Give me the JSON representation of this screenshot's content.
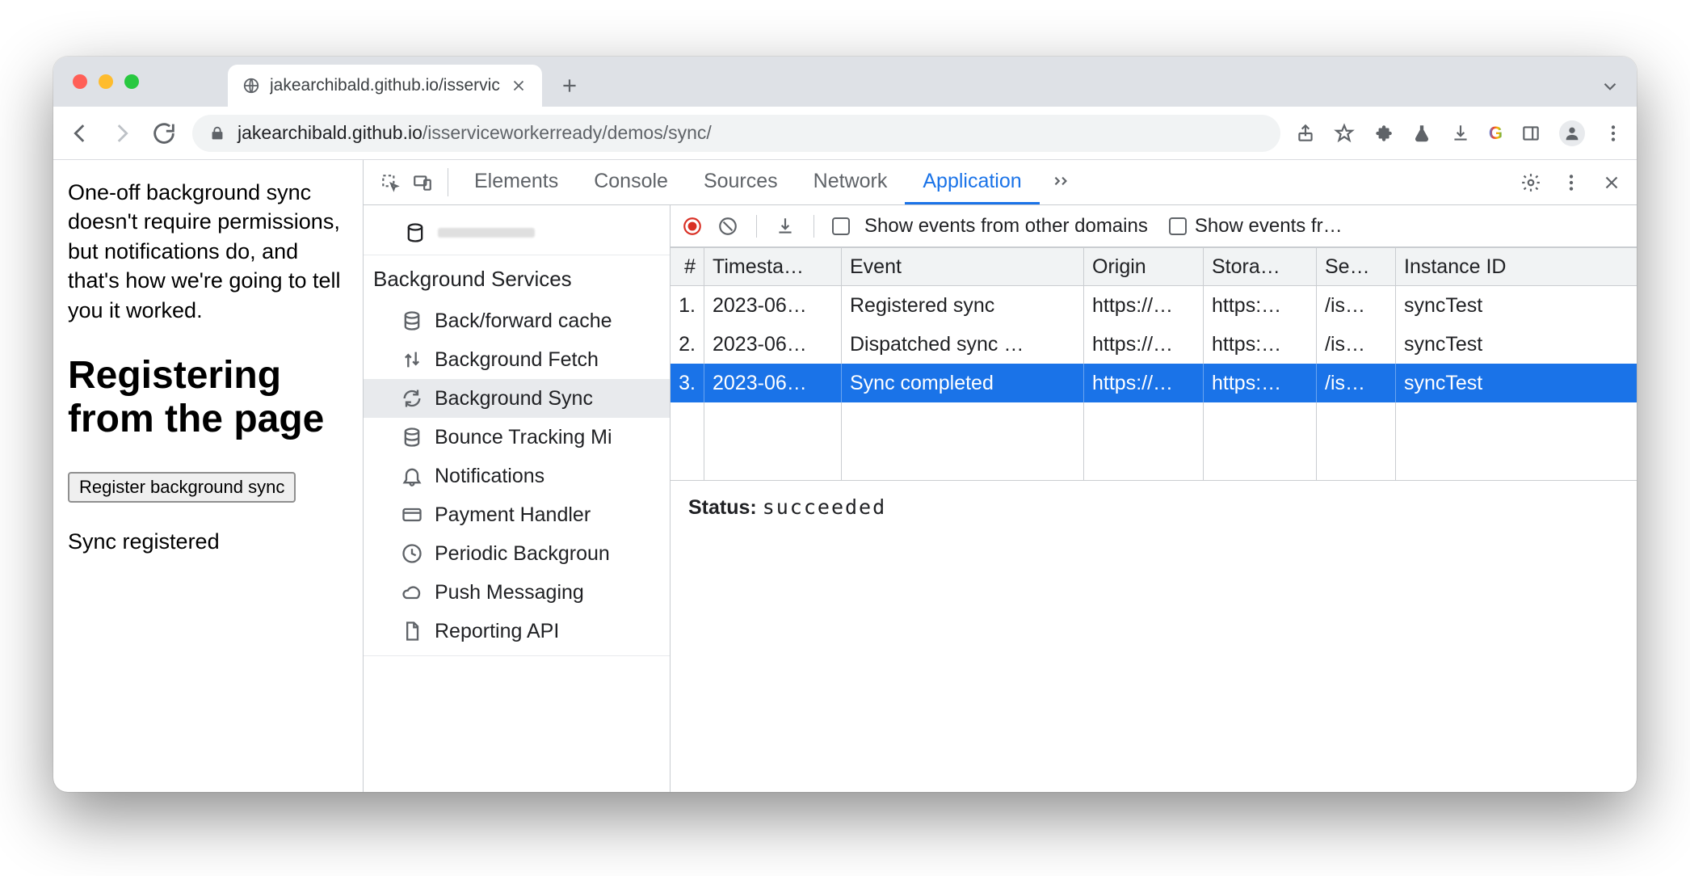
{
  "tab": {
    "title": "jakearchibald.github.io/isservic"
  },
  "omnibox": {
    "host": "jakearchibald.github.io",
    "path": "/isserviceworkerready/demos/sync/"
  },
  "page": {
    "intro": "One-off background sync doesn't require permissions, but notifications do, and that's how we're going to tell you it worked.",
    "heading": "Registering from the page",
    "button": "Register background sync",
    "status": "Sync registered"
  },
  "devtools": {
    "tabs": [
      "Elements",
      "Console",
      "Sources",
      "Network",
      "Application"
    ],
    "active_tab": "Application",
    "sidebar": {
      "group": "Background Services",
      "items": [
        {
          "icon": "db",
          "label": "Back/forward cache"
        },
        {
          "icon": "updown",
          "label": "Background Fetch"
        },
        {
          "icon": "sync",
          "label": "Background Sync"
        },
        {
          "icon": "db",
          "label": "Bounce Tracking Mi"
        },
        {
          "icon": "bell",
          "label": "Notifications"
        },
        {
          "icon": "card",
          "label": "Payment Handler"
        },
        {
          "icon": "clock",
          "label": "Periodic Backgroun"
        },
        {
          "icon": "cloud",
          "label": "Push Messaging"
        },
        {
          "icon": "file",
          "label": "Reporting API"
        }
      ],
      "selected": "Background Sync"
    },
    "toolbar": {
      "checkbox1": "Show events from other domains",
      "checkbox2": "Show events fr…"
    },
    "grid": {
      "columns": [
        "#",
        "Timesta…",
        "Event",
        "Origin",
        "Stora…",
        "Se…",
        "Instance ID"
      ],
      "rows": [
        {
          "idx": "1.",
          "ts": "2023-06…",
          "event": "Registered sync",
          "origin": "https://…",
          "storage": "https:…",
          "scope": "/is…",
          "id": "syncTest"
        },
        {
          "idx": "2.",
          "ts": "2023-06…",
          "event": "Dispatched sync …",
          "origin": "https://…",
          "storage": "https:…",
          "scope": "/is…",
          "id": "syncTest"
        },
        {
          "idx": "3.",
          "ts": "2023-06…",
          "event": "Sync completed",
          "origin": "https://…",
          "storage": "https:…",
          "scope": "/is…",
          "id": "syncTest"
        }
      ],
      "selected_index": 2
    },
    "status": {
      "label": "Status:",
      "value": "succeeded"
    }
  }
}
